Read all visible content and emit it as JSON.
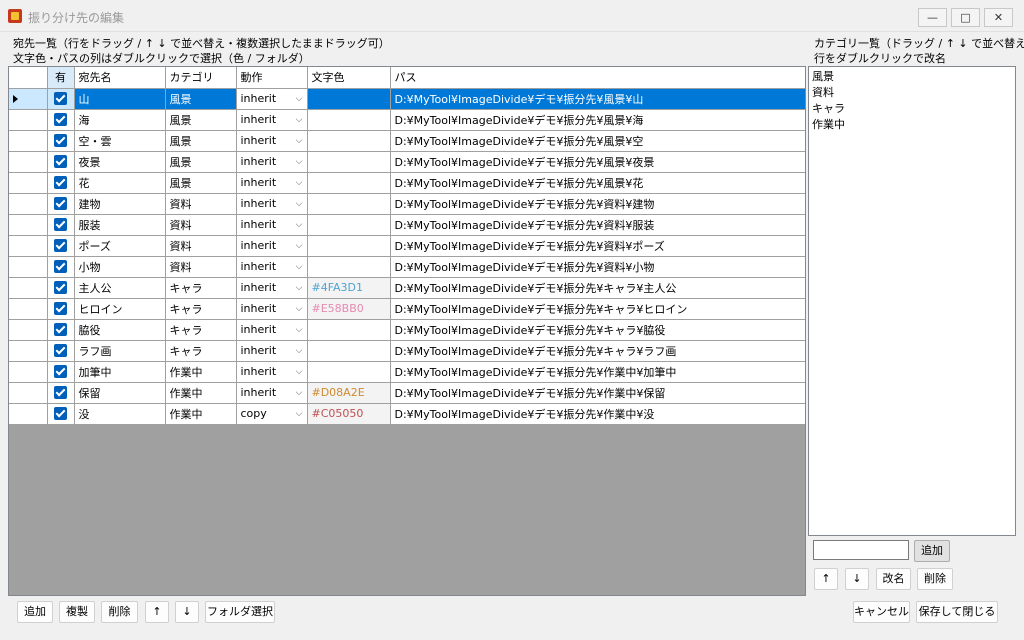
{
  "window": {
    "title": "振り分け先の編集",
    "minimize": "—",
    "maximize": "□",
    "close": "✕"
  },
  "left_header": {
    "line1": "宛先一覧（行をドラッグ / ↑ ↓ で並べ替え・複数選択したままドラッグ可）",
    "line2": "文字色・パスの列はダブルクリックで選択（色 / フォルダ）"
  },
  "right_header": {
    "line1": "カテゴリ一覧（ドラッグ / ↑ ↓ で並べ替え）",
    "line2": "行をダブルクリックで改名"
  },
  "columns": {
    "enabled": "有",
    "name": "宛先名",
    "category": "カテゴリ",
    "action": "動作",
    "color": "文字色",
    "path": "パス"
  },
  "rows": [
    {
      "enabled": true,
      "name": "山",
      "category": "風景",
      "action": "inherit",
      "color": "",
      "path": "D:¥MyTool¥ImageDivide¥デモ¥振分先¥風景¥山",
      "selected": true
    },
    {
      "enabled": true,
      "name": "海",
      "category": "風景",
      "action": "inherit",
      "color": "",
      "path": "D:¥MyTool¥ImageDivide¥デモ¥振分先¥風景¥海"
    },
    {
      "enabled": true,
      "name": "空・雲",
      "category": "風景",
      "action": "inherit",
      "color": "",
      "path": "D:¥MyTool¥ImageDivide¥デモ¥振分先¥風景¥空"
    },
    {
      "enabled": true,
      "name": "夜景",
      "category": "風景",
      "action": "inherit",
      "color": "",
      "path": "D:¥MyTool¥ImageDivide¥デモ¥振分先¥風景¥夜景"
    },
    {
      "enabled": true,
      "name": "花",
      "category": "風景",
      "action": "inherit",
      "color": "",
      "path": "D:¥MyTool¥ImageDivide¥デモ¥振分先¥風景¥花"
    },
    {
      "enabled": true,
      "name": "建物",
      "category": "資料",
      "action": "inherit",
      "color": "",
      "path": "D:¥MyTool¥ImageDivide¥デモ¥振分先¥資料¥建物"
    },
    {
      "enabled": true,
      "name": "服装",
      "category": "資料",
      "action": "inherit",
      "color": "",
      "path": "D:¥MyTool¥ImageDivide¥デモ¥振分先¥資料¥服装"
    },
    {
      "enabled": true,
      "name": "ポーズ",
      "category": "資料",
      "action": "inherit",
      "color": "",
      "path": "D:¥MyTool¥ImageDivide¥デモ¥振分先¥資料¥ポーズ"
    },
    {
      "enabled": true,
      "name": "小物",
      "category": "資料",
      "action": "inherit",
      "color": "",
      "path": "D:¥MyTool¥ImageDivide¥デモ¥振分先¥資料¥小物"
    },
    {
      "enabled": true,
      "name": "主人公",
      "category": "キャラ",
      "action": "inherit",
      "color": "#4FA3D1",
      "path": "D:¥MyTool¥ImageDivide¥デモ¥振分先¥キャラ¥主人公"
    },
    {
      "enabled": true,
      "name": "ヒロイン",
      "category": "キャラ",
      "action": "inherit",
      "color": "#E58BB0",
      "path": "D:¥MyTool¥ImageDivide¥デモ¥振分先¥キャラ¥ヒロイン"
    },
    {
      "enabled": true,
      "name": "脇役",
      "category": "キャラ",
      "action": "inherit",
      "color": "",
      "path": "D:¥MyTool¥ImageDivide¥デモ¥振分先¥キャラ¥脇役"
    },
    {
      "enabled": true,
      "name": "ラフ画",
      "category": "キャラ",
      "action": "inherit",
      "color": "",
      "path": "D:¥MyTool¥ImageDivide¥デモ¥振分先¥キャラ¥ラフ画"
    },
    {
      "enabled": true,
      "name": "加筆中",
      "category": "作業中",
      "action": "inherit",
      "color": "",
      "path": "D:¥MyTool¥ImageDivide¥デモ¥振分先¥作業中¥加筆中"
    },
    {
      "enabled": true,
      "name": "保留",
      "category": "作業中",
      "action": "inherit",
      "color": "#D08A2E",
      "path": "D:¥MyTool¥ImageDivide¥デモ¥振分先¥作業中¥保留"
    },
    {
      "enabled": true,
      "name": "没",
      "category": "作業中",
      "action": "copy",
      "color": "#C05050",
      "path": "D:¥MyTool¥ImageDivide¥デモ¥振分先¥作業中¥没"
    }
  ],
  "categories": [
    "風景",
    "資料",
    "キャラ",
    "作業中"
  ],
  "category_input": {
    "value": ""
  },
  "category_buttons": {
    "add": "追加",
    "up": "↑",
    "down": "↓",
    "rename": "改名",
    "delete": "削除"
  },
  "bottom_buttons": {
    "add": "追加",
    "duplicate": "複製",
    "delete": "削除",
    "up": "↑",
    "down": "↓",
    "folder": "フォルダ選択"
  },
  "dialog_buttons": {
    "cancel": "キャンセル",
    "save_close": "保存して閉じる"
  },
  "colors": {
    "selection": "#0078d7",
    "checkbox": "#005fb8"
  }
}
